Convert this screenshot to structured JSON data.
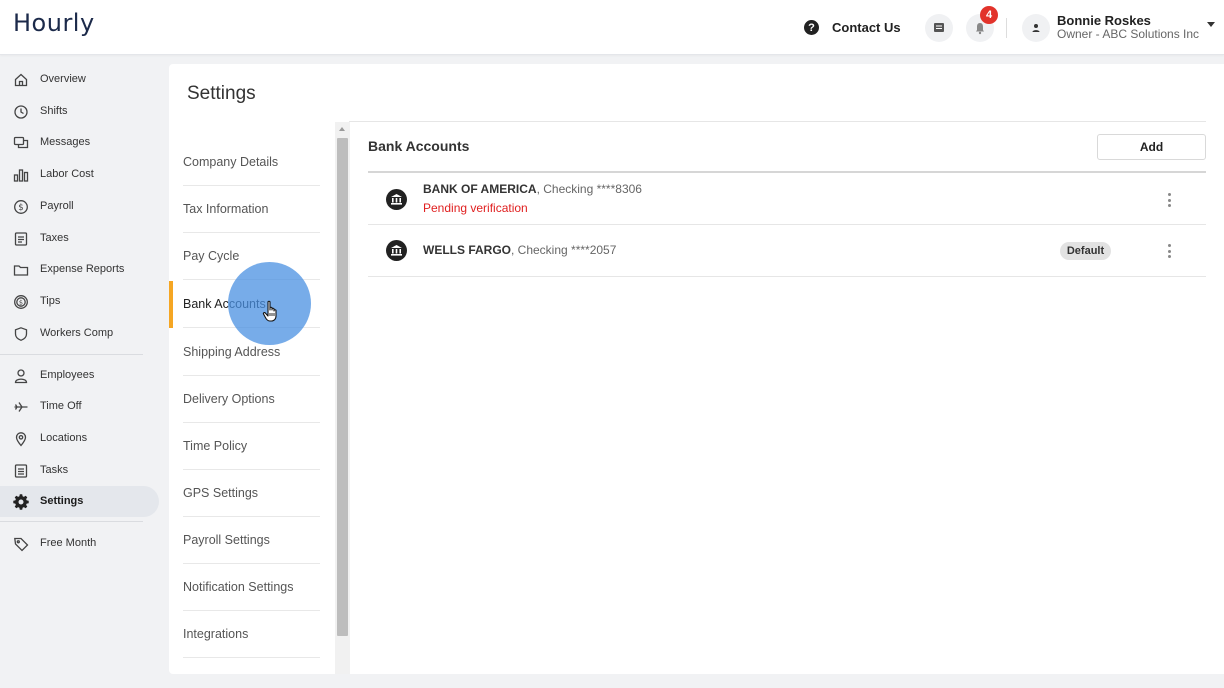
{
  "app": {
    "logo": "Hourly"
  },
  "header": {
    "contact_label": "Contact Us",
    "notifications_count": "4",
    "user_name": "Bonnie Roskes",
    "user_role": "Owner - ABC Solutions Inc"
  },
  "nav": {
    "items": [
      {
        "label": "Overview",
        "icon": "home-icon"
      },
      {
        "label": "Shifts",
        "icon": "clock-icon"
      },
      {
        "label": "Messages",
        "icon": "chat-icon"
      },
      {
        "label": "Labor Cost",
        "icon": "bar-chart-icon"
      },
      {
        "label": "Payroll",
        "icon": "dollar-circle-icon"
      },
      {
        "label": "Taxes",
        "icon": "document-icon"
      },
      {
        "label": "Expense Reports",
        "icon": "folder-icon"
      },
      {
        "label": "Tips",
        "icon": "coin-icon"
      },
      {
        "label": "Workers Comp",
        "icon": "shield-icon"
      },
      {
        "label": "Employees",
        "icon": "person-icon"
      },
      {
        "label": "Time Off",
        "icon": "plane-icon"
      },
      {
        "label": "Locations",
        "icon": "pin-icon"
      },
      {
        "label": "Tasks",
        "icon": "checklist-icon"
      },
      {
        "label": "Settings",
        "icon": "gear-icon",
        "active": true
      },
      {
        "label": "Free Month",
        "icon": "tag-icon"
      }
    ]
  },
  "settings": {
    "title": "Settings",
    "submenu": [
      "Company Details",
      "Tax Information",
      "Pay Cycle",
      "Bank Accounts",
      "Shipping Address",
      "Delivery Options",
      "Time Policy",
      "GPS Settings",
      "Payroll Settings",
      "Notification Settings",
      "Integrations"
    ],
    "active_submenu": "Bank Accounts"
  },
  "bank_accounts": {
    "title": "Bank Accounts",
    "add_label": "Add",
    "accounts": [
      {
        "bank": "BANK OF AMERICA",
        "detail": ", Checking ****8306",
        "status": "Pending verification",
        "badge": ""
      },
      {
        "bank": "WELLS FARGO",
        "detail": ", Checking ****2057",
        "status": "",
        "badge": "Default"
      }
    ]
  },
  "colors": {
    "accent": "#f5a623",
    "error": "#e02020",
    "notification_badge": "#e2332b",
    "click_highlight": "#4a90e2"
  }
}
